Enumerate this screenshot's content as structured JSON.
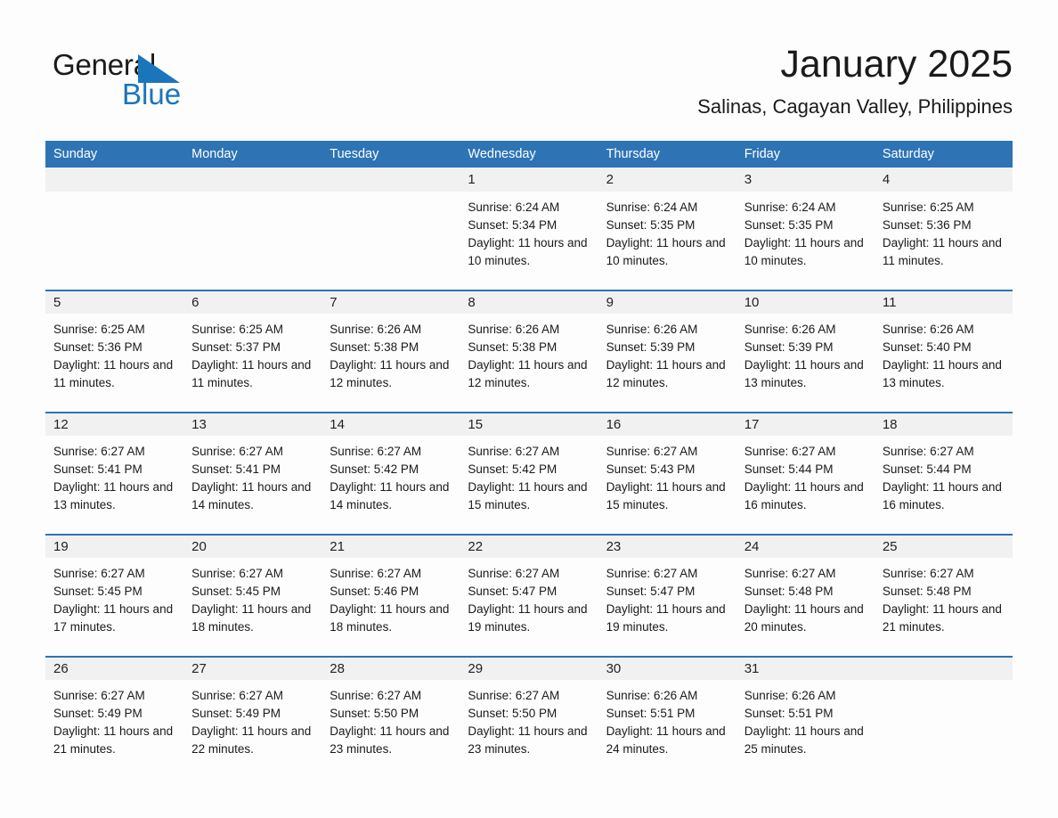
{
  "brand": {
    "name_part1": "General",
    "name_part2": "Blue",
    "triangle_icon": "blue-triangle-icon",
    "accent_color": "#1b75bb"
  },
  "header": {
    "title": "January 2025",
    "location": "Salinas, Cagayan Valley, Philippines"
  },
  "theme": {
    "header_blue": "#2e74b5",
    "date_band_gray": "#f1f1f1",
    "page_background": "#fdfdfd",
    "text_color": "#1a1a1a"
  },
  "calendar": {
    "weekdays": [
      "Sunday",
      "Monday",
      "Tuesday",
      "Wednesday",
      "Thursday",
      "Friday",
      "Saturday"
    ],
    "weeks": [
      [
        {
          "day": "",
          "sunrise": "",
          "sunset": "",
          "daylight": ""
        },
        {
          "day": "",
          "sunrise": "",
          "sunset": "",
          "daylight": ""
        },
        {
          "day": "",
          "sunrise": "",
          "sunset": "",
          "daylight": ""
        },
        {
          "day": "1",
          "sunrise": "Sunrise: 6:24 AM",
          "sunset": "Sunset: 5:34 PM",
          "daylight": "Daylight: 11 hours and 10 minutes."
        },
        {
          "day": "2",
          "sunrise": "Sunrise: 6:24 AM",
          "sunset": "Sunset: 5:35 PM",
          "daylight": "Daylight: 11 hours and 10 minutes."
        },
        {
          "day": "3",
          "sunrise": "Sunrise: 6:24 AM",
          "sunset": "Sunset: 5:35 PM",
          "daylight": "Daylight: 11 hours and 10 minutes."
        },
        {
          "day": "4",
          "sunrise": "Sunrise: 6:25 AM",
          "sunset": "Sunset: 5:36 PM",
          "daylight": "Daylight: 11 hours and 11 minutes."
        }
      ],
      [
        {
          "day": "5",
          "sunrise": "Sunrise: 6:25 AM",
          "sunset": "Sunset: 5:36 PM",
          "daylight": "Daylight: 11 hours and 11 minutes."
        },
        {
          "day": "6",
          "sunrise": "Sunrise: 6:25 AM",
          "sunset": "Sunset: 5:37 PM",
          "daylight": "Daylight: 11 hours and 11 minutes."
        },
        {
          "day": "7",
          "sunrise": "Sunrise: 6:26 AM",
          "sunset": "Sunset: 5:38 PM",
          "daylight": "Daylight: 11 hours and 12 minutes."
        },
        {
          "day": "8",
          "sunrise": "Sunrise: 6:26 AM",
          "sunset": "Sunset: 5:38 PM",
          "daylight": "Daylight: 11 hours and 12 minutes."
        },
        {
          "day": "9",
          "sunrise": "Sunrise: 6:26 AM",
          "sunset": "Sunset: 5:39 PM",
          "daylight": "Daylight: 11 hours and 12 minutes."
        },
        {
          "day": "10",
          "sunrise": "Sunrise: 6:26 AM",
          "sunset": "Sunset: 5:39 PM",
          "daylight": "Daylight: 11 hours and 13 minutes."
        },
        {
          "day": "11",
          "sunrise": "Sunrise: 6:26 AM",
          "sunset": "Sunset: 5:40 PM",
          "daylight": "Daylight: 11 hours and 13 minutes."
        }
      ],
      [
        {
          "day": "12",
          "sunrise": "Sunrise: 6:27 AM",
          "sunset": "Sunset: 5:41 PM",
          "daylight": "Daylight: 11 hours and 13 minutes."
        },
        {
          "day": "13",
          "sunrise": "Sunrise: 6:27 AM",
          "sunset": "Sunset: 5:41 PM",
          "daylight": "Daylight: 11 hours and 14 minutes."
        },
        {
          "day": "14",
          "sunrise": "Sunrise: 6:27 AM",
          "sunset": "Sunset: 5:42 PM",
          "daylight": "Daylight: 11 hours and 14 minutes."
        },
        {
          "day": "15",
          "sunrise": "Sunrise: 6:27 AM",
          "sunset": "Sunset: 5:42 PM",
          "daylight": "Daylight: 11 hours and 15 minutes."
        },
        {
          "day": "16",
          "sunrise": "Sunrise: 6:27 AM",
          "sunset": "Sunset: 5:43 PM",
          "daylight": "Daylight: 11 hours and 15 minutes."
        },
        {
          "day": "17",
          "sunrise": "Sunrise: 6:27 AM",
          "sunset": "Sunset: 5:44 PM",
          "daylight": "Daylight: 11 hours and 16 minutes."
        },
        {
          "day": "18",
          "sunrise": "Sunrise: 6:27 AM",
          "sunset": "Sunset: 5:44 PM",
          "daylight": "Daylight: 11 hours and 16 minutes."
        }
      ],
      [
        {
          "day": "19",
          "sunrise": "Sunrise: 6:27 AM",
          "sunset": "Sunset: 5:45 PM",
          "daylight": "Daylight: 11 hours and 17 minutes."
        },
        {
          "day": "20",
          "sunrise": "Sunrise: 6:27 AM",
          "sunset": "Sunset: 5:45 PM",
          "daylight": "Daylight: 11 hours and 18 minutes."
        },
        {
          "day": "21",
          "sunrise": "Sunrise: 6:27 AM",
          "sunset": "Sunset: 5:46 PM",
          "daylight": "Daylight: 11 hours and 18 minutes."
        },
        {
          "day": "22",
          "sunrise": "Sunrise: 6:27 AM",
          "sunset": "Sunset: 5:47 PM",
          "daylight": "Daylight: 11 hours and 19 minutes."
        },
        {
          "day": "23",
          "sunrise": "Sunrise: 6:27 AM",
          "sunset": "Sunset: 5:47 PM",
          "daylight": "Daylight: 11 hours and 19 minutes."
        },
        {
          "day": "24",
          "sunrise": "Sunrise: 6:27 AM",
          "sunset": "Sunset: 5:48 PM",
          "daylight": "Daylight: 11 hours and 20 minutes."
        },
        {
          "day": "25",
          "sunrise": "Sunrise: 6:27 AM",
          "sunset": "Sunset: 5:48 PM",
          "daylight": "Daylight: 11 hours and 21 minutes."
        }
      ],
      [
        {
          "day": "26",
          "sunrise": "Sunrise: 6:27 AM",
          "sunset": "Sunset: 5:49 PM",
          "daylight": "Daylight: 11 hours and 21 minutes."
        },
        {
          "day": "27",
          "sunrise": "Sunrise: 6:27 AM",
          "sunset": "Sunset: 5:49 PM",
          "daylight": "Daylight: 11 hours and 22 minutes."
        },
        {
          "day": "28",
          "sunrise": "Sunrise: 6:27 AM",
          "sunset": "Sunset: 5:50 PM",
          "daylight": "Daylight: 11 hours and 23 minutes."
        },
        {
          "day": "29",
          "sunrise": "Sunrise: 6:27 AM",
          "sunset": "Sunset: 5:50 PM",
          "daylight": "Daylight: 11 hours and 23 minutes."
        },
        {
          "day": "30",
          "sunrise": "Sunrise: 6:26 AM",
          "sunset": "Sunset: 5:51 PM",
          "daylight": "Daylight: 11 hours and 24 minutes."
        },
        {
          "day": "31",
          "sunrise": "Sunrise: 6:26 AM",
          "sunset": "Sunset: 5:51 PM",
          "daylight": "Daylight: 11 hours and 25 minutes."
        },
        {
          "day": "",
          "sunrise": "",
          "sunset": "",
          "daylight": ""
        }
      ]
    ]
  }
}
